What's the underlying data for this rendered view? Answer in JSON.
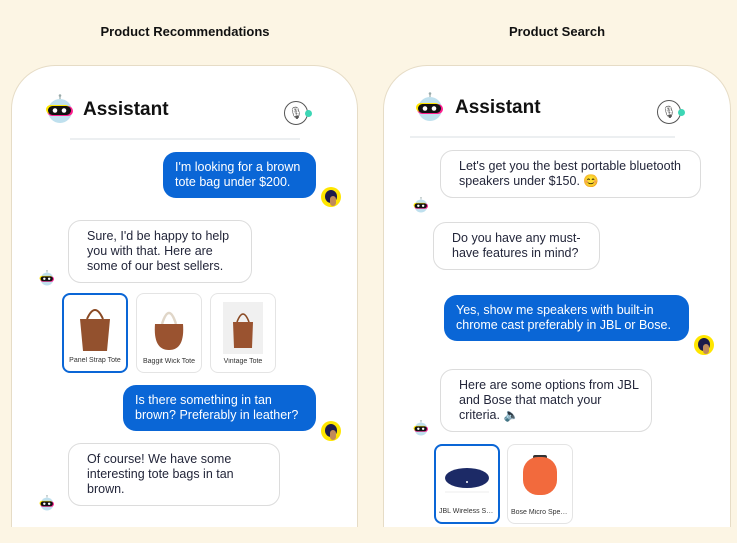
{
  "left": {
    "section_title": "Product Recommendations",
    "header": {
      "title": "Assistant"
    },
    "messages": [
      {
        "from": "user",
        "text": "I'm looking for a brown tote bag under $200."
      },
      {
        "from": "bot",
        "text": "Sure, I'd be happy to help you with that. Here are some of our best sellers."
      },
      {
        "from": "user",
        "text": "Is there something in tan brown? Preferably in leather?"
      },
      {
        "from": "bot",
        "text": "Of course! We have some interesting tote bags in tan brown."
      }
    ],
    "products": [
      {
        "name": "Panel Strap Tote",
        "selected": true
      },
      {
        "name": "Baggit Wick Tote",
        "selected": false
      },
      {
        "name": "Vintage Tote",
        "selected": false
      }
    ]
  },
  "right": {
    "section_title": "Product Search",
    "header": {
      "title": "Assistant"
    },
    "messages": [
      {
        "from": "bot",
        "text": "Let's get you the best portable bluetooth speakers under $150. 😊"
      },
      {
        "from": "bot",
        "text": "Do you have any must-have features in mind?"
      },
      {
        "from": "user",
        "text": "Yes, show me speakers with built-in chrome cast preferably in JBL or Bose."
      },
      {
        "from": "bot",
        "text": "Here are some options from JBL and Bose that match your criteria. 🔈"
      }
    ],
    "products": [
      {
        "name": "JBL Wireless Sp...",
        "selected": true
      },
      {
        "name": "Bose Micro Spea...",
        "selected": false
      }
    ]
  },
  "colors": {
    "background": "#fcf5e4",
    "user_bubble": "#0a66d6",
    "mic_status": "#3dd6b5",
    "avatar": "#ffe600"
  }
}
